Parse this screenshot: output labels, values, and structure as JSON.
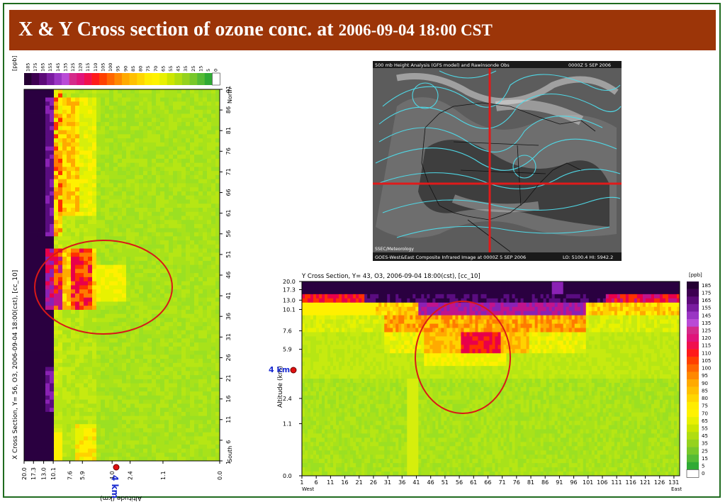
{
  "slide": {
    "title_main": "X & Y Cross section of ozone conc. at ",
    "title_date": "2006-09-04 18:00 CST"
  },
  "colorbar": {
    "unit": "[ppb]",
    "levels": [
      "185",
      "175",
      "165",
      "155",
      "145",
      "135",
      "125",
      "120",
      "115",
      "110",
      "105",
      "100",
      "95",
      "90",
      "85",
      "80",
      "75",
      "70",
      "65",
      "55",
      "45",
      "35",
      "25",
      "15",
      "5",
      "0"
    ],
    "colors": [
      "#250033",
      "#3d0050",
      "#5c0a78",
      "#7a1ca0",
      "#9a35c4",
      "#b94ad6",
      "#d42a8a",
      "#e0147a",
      "#f0104e",
      "#ff1a1a",
      "#ff4000",
      "#ff6600",
      "#ff8800",
      "#ffaa00",
      "#ffc000",
      "#ffd600",
      "#ffec00",
      "#fff200",
      "#e8f000",
      "#cce600",
      "#b0dd10",
      "#95d21e",
      "#78c82a",
      "#55bb35",
      "#30aa35",
      "#ffffff"
    ]
  },
  "map": {
    "top_caption": "500 mb Height Analysis (GFS model) and Rawinsonde Obs",
    "top_date": "0000Z 5 SEP 2006",
    "credit": "SSEC/Meteorology",
    "bottom_caption": "GOES-West&East Composite Infrared Image at 0000Z 5 SEP 2006",
    "bottom_stats": "LO: 5100.4   HI: 5942.2"
  },
  "annotations": {
    "alt_marker": "4 km"
  },
  "chart_data": [
    {
      "type": "heatmap",
      "panel": "x-section",
      "title": "X Cross Section, Y= 56, O3, 2006-09-04 18:00(cst), [cc_10]",
      "ylabel": "Altitude (km)",
      "altitude_ticks": [
        "20.0",
        "17.3",
        "13.0",
        "10.1",
        "7.6",
        "5.9",
        "4.0",
        "2.4",
        "1.1",
        "0.0"
      ],
      "altitude_fracs": [
        0.0,
        0.048,
        0.1,
        0.149,
        0.234,
        0.298,
        0.45,
        0.542,
        0.71,
        1.0
      ],
      "y_index_ticks": [
        "91",
        "86",
        "81",
        "76",
        "71",
        "66",
        "61",
        "56",
        "51",
        "46",
        "41",
        "36",
        "31",
        "26",
        "21",
        "16",
        "11",
        "6",
        "1"
      ],
      "y_dir_top": "North",
      "y_dir_bottom": "South",
      "highlight": "ozone maximum near 5-8 km, Y-index 41-51"
    },
    {
      "type": "heatmap",
      "panel": "y-section",
      "title": "Y Cross Section, Y= 43, O3, 2006-09-04 18:00(cst), [cc_10]",
      "ylabel": "Altitude (km)",
      "altitude_ticks": [
        "20.0",
        "17.3",
        "13.0",
        "10.1",
        "7.6",
        "5.9",
        "2.4",
        "1.1",
        "0.0"
      ],
      "altitude_fracs": [
        0.0,
        0.042,
        0.096,
        0.144,
        0.254,
        0.349,
        0.602,
        0.732,
        1.0
      ],
      "x_ticks": [
        "1",
        "6",
        "11",
        "16",
        "21",
        "26",
        "31",
        "36",
        "41",
        "46",
        "51",
        "56",
        "61",
        "66",
        "71",
        "76",
        "81",
        "86",
        "91",
        "96",
        "101",
        "106",
        "111",
        "116",
        "121",
        "126",
        "131"
      ],
      "x_dir_left": "West",
      "x_dir_right": "East",
      "highlight": "ozone maximum near 5-8 km, X-index 46-71"
    }
  ]
}
